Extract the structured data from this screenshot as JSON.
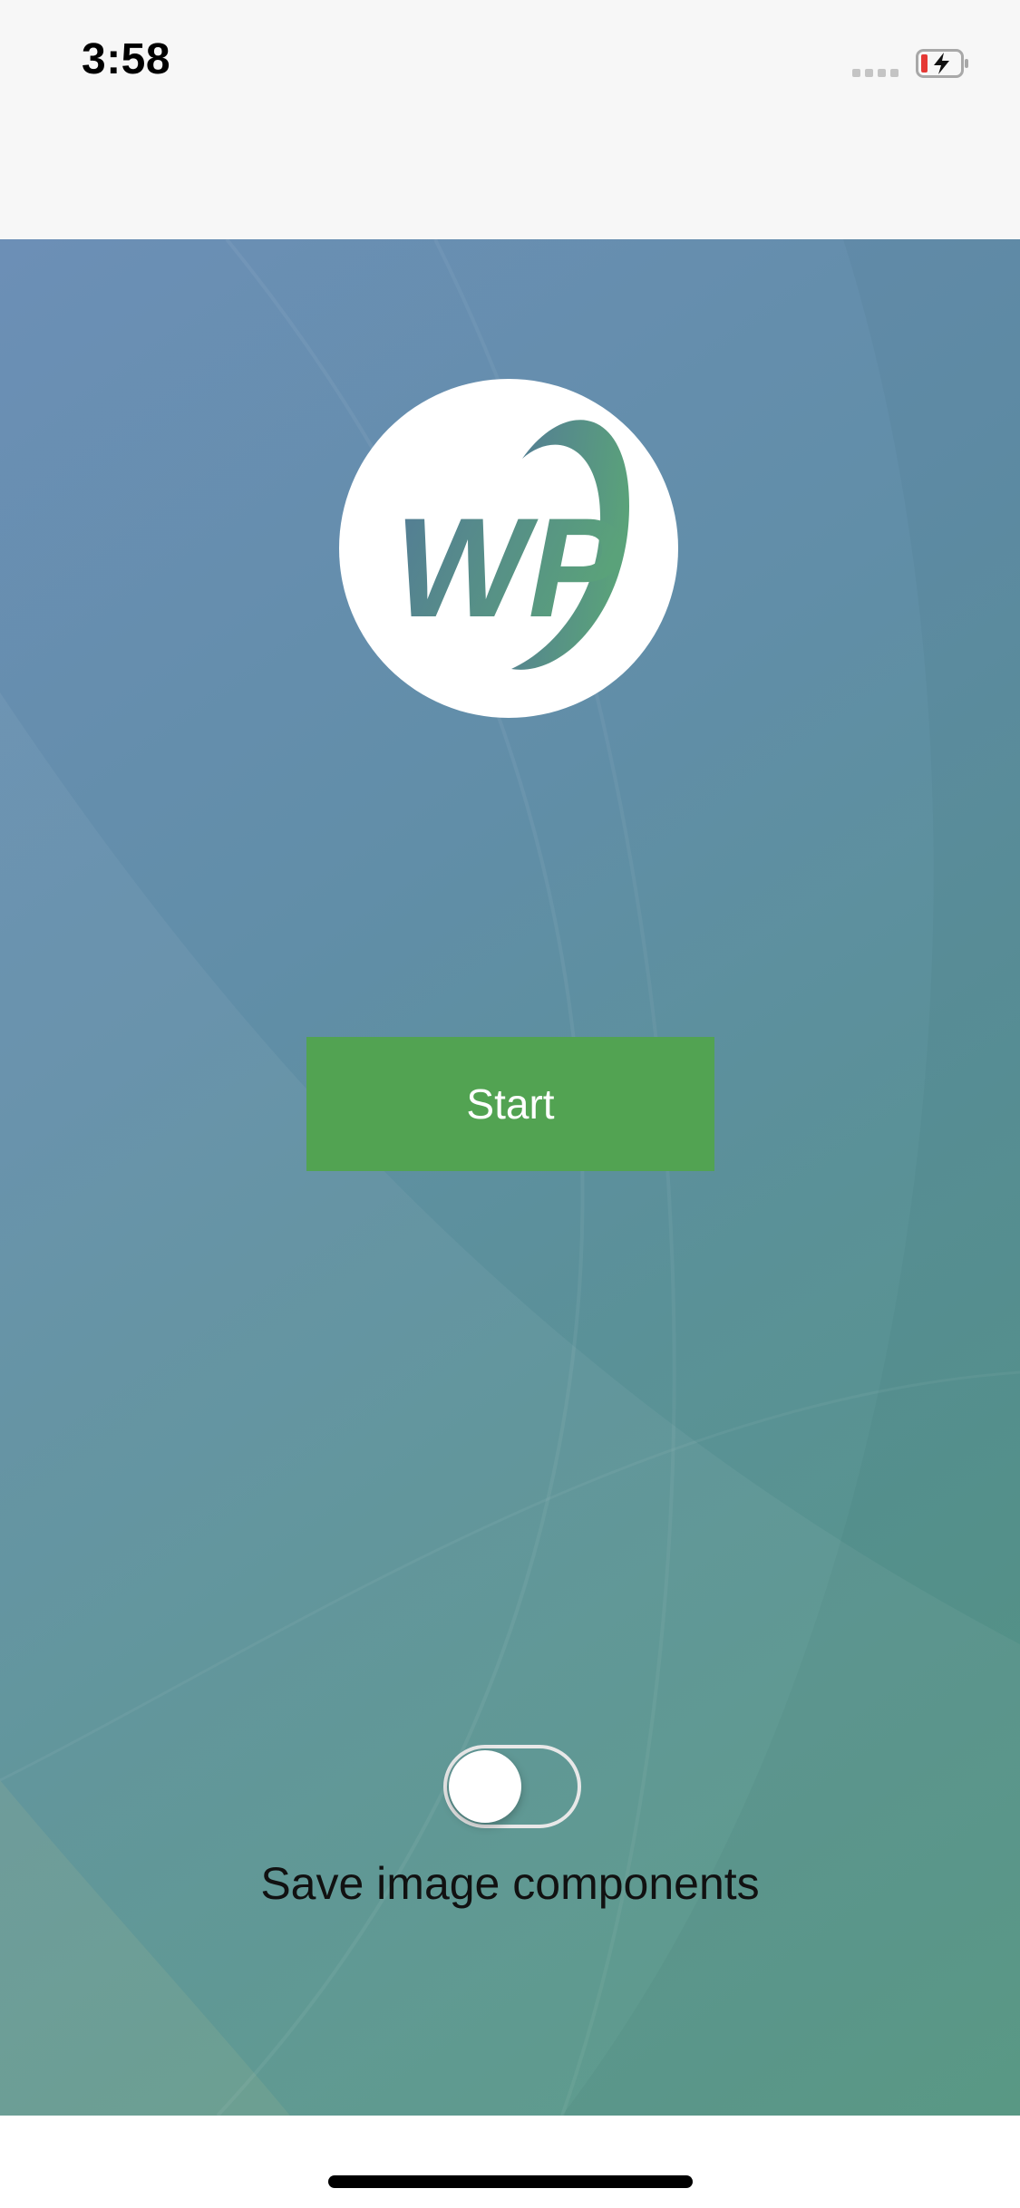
{
  "status_bar": {
    "time": "3:58",
    "signal_icon": "signal-dots-icon",
    "battery_icon": "battery-charging-icon",
    "battery_low_color": "#e53935"
  },
  "logo": {
    "text": "WP",
    "icon": "wp-logo-icon"
  },
  "start_button": {
    "label": "Start",
    "color": "#52a352"
  },
  "save_components": {
    "label": "Save image components",
    "toggle_on": false
  }
}
